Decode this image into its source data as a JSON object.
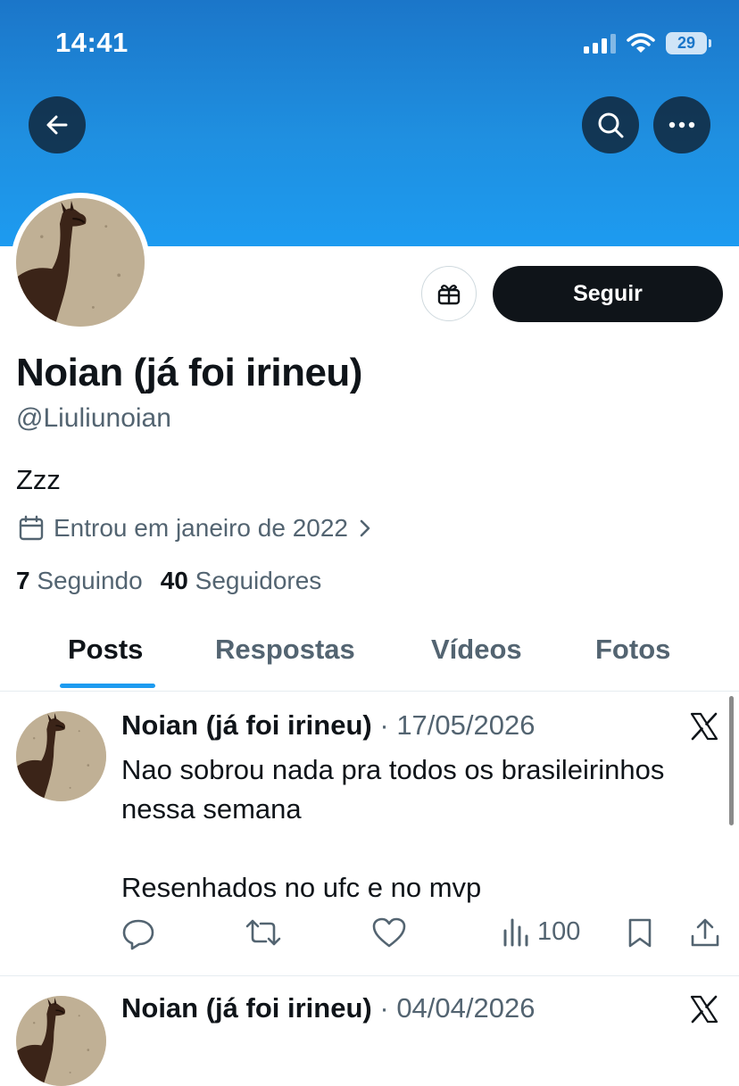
{
  "status_bar": {
    "time": "14:41",
    "battery": "29"
  },
  "profile": {
    "display_name": "Noian (já foi irineu)",
    "handle": "@Liuliunoian",
    "bio": "Zzz",
    "joined": "Entrou em janeiro de 2022",
    "following_count": "7",
    "following_label": "Seguindo",
    "followers_count": "40",
    "followers_label": "Seguidores",
    "follow_button": "Seguir"
  },
  "tabs": [
    {
      "label": "Posts",
      "active": true
    },
    {
      "label": "Respostas",
      "active": false
    },
    {
      "label": "Vídeos",
      "active": false
    },
    {
      "label": "Fotos",
      "active": false
    }
  ],
  "posts": [
    {
      "author": "Noian (já foi irineu)",
      "separator": "·",
      "date": "17/05/2026",
      "text": "Nao sobrou nada pra todos os brasileirinhos nessa semana\n\nResenhados no ufc e no mvp",
      "views": "100"
    },
    {
      "author": "Noian (já foi irineu)",
      "separator": "·",
      "date": "04/04/2026"
    }
  ],
  "colors": {
    "accent": "#1d9bf0",
    "banner": "#1b76c9",
    "text": "#0f1419",
    "muted": "#536471"
  },
  "icons": [
    "back-arrow-icon",
    "search-icon",
    "more-icon",
    "gift-icon",
    "calendar-icon",
    "chevron-right-icon",
    "x-logo-icon",
    "reply-icon",
    "repost-icon",
    "like-icon",
    "views-icon",
    "bookmark-icon",
    "share-icon"
  ]
}
